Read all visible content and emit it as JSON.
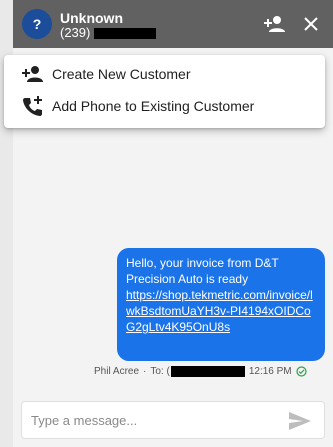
{
  "header": {
    "avatar_text": "?",
    "contact_name": "Unknown",
    "contact_phone_prefix": "(239)"
  },
  "menu": {
    "items": [
      {
        "label": "Create New Customer",
        "icon": "person-add-icon"
      },
      {
        "label": "Add Phone to Existing Customer",
        "icon": "phone-add-icon"
      }
    ]
  },
  "message": {
    "text": "Hello, your invoice from D&T Precision Auto is ready",
    "link": "https://shop.tekmetric.com/invoice/lwkBsdtomUaYH3v-PI4194xOIDCoG2gLtv4K95OnU8s",
    "sender": "Phil Acree",
    "to_label": "To: (",
    "time": "12:16 PM",
    "status_icon": "delivered-check-icon"
  },
  "composer": {
    "placeholder": "Type a message..."
  },
  "colors": {
    "header_bg": "#616161",
    "avatar_bg": "#1b4d9a",
    "bubble_bg": "#1a73e8",
    "delivered": "#2e9d4e"
  }
}
